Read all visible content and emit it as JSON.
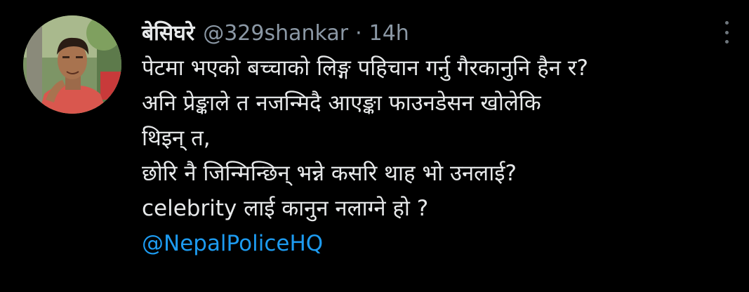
{
  "tweet": {
    "author": {
      "display_name": "बेसिघरे",
      "handle": "@329shankar"
    },
    "separator": "·",
    "timestamp": "14h",
    "lines": [
      "पेटमा भएको बच्चाको लिङ्ग पहिचान गर्नु गैरकानुनि हैन र?",
      "अनि प्रेङ्काले त नजन्मिदै आएङ्का फाउनडेसन खोलेकि",
      "थिइन् त,",
      "छोरि नै जिन्मिन्छिन् भन्ने कसरि थाह भो उनलाई?",
      "celebrity लाई कानुन नलाग्ने हो ?"
    ],
    "mention": "@NepalPoliceHQ"
  },
  "icons": {
    "more": "more-vertical-icon",
    "avatar": "profile-photo"
  },
  "colors": {
    "background": "#000000",
    "text": "#e7e9ea",
    "secondary": "#8b98a5",
    "link": "#1d9bf0"
  }
}
